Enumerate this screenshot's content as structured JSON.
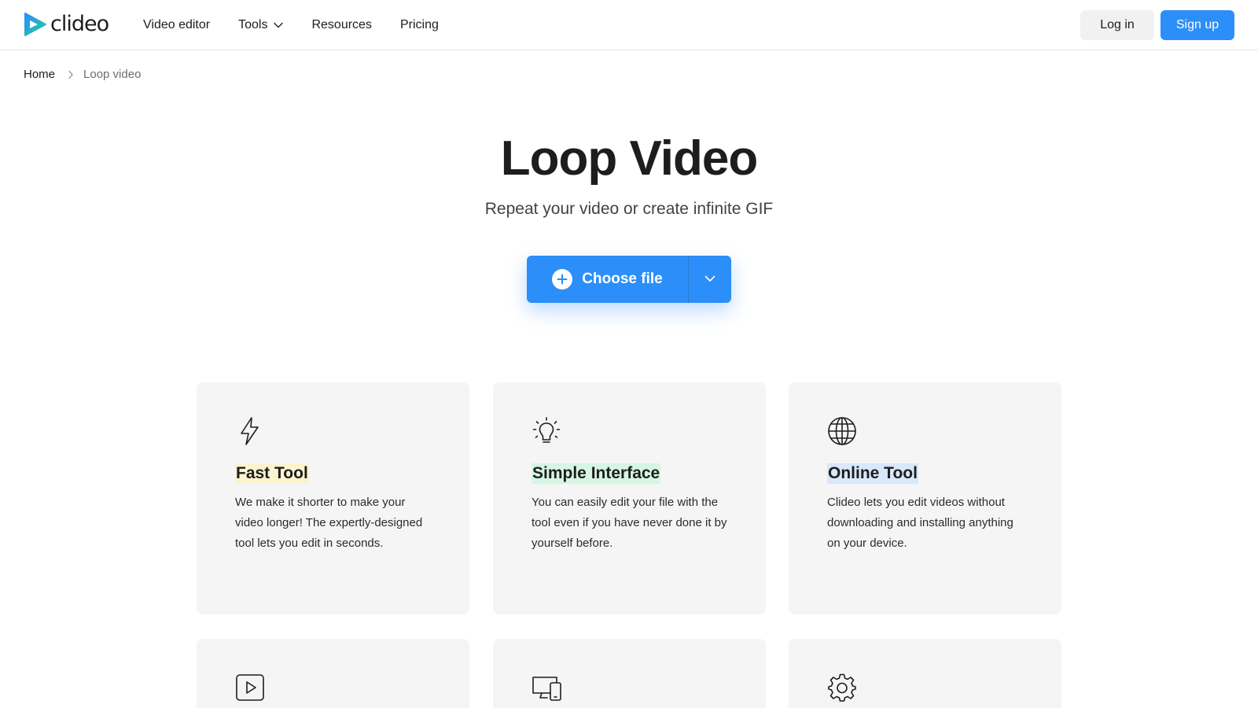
{
  "brand": {
    "name": "clideo",
    "primary": "#2c8ef8",
    "logo_gradient": [
      "#2c8ef8",
      "#1fcf9e"
    ]
  },
  "nav": {
    "items": [
      {
        "label": "Video editor",
        "has_dropdown": false
      },
      {
        "label": "Tools",
        "has_dropdown": true
      },
      {
        "label": "Resources",
        "has_dropdown": false
      },
      {
        "label": "Pricing",
        "has_dropdown": false
      }
    ],
    "login_label": "Log in",
    "signup_label": "Sign up"
  },
  "breadcrumb": {
    "home": "Home",
    "current": "Loop video"
  },
  "hero": {
    "title": "Loop Video",
    "subtitle": "Repeat your video or create infinite GIF",
    "upload_label": "Choose file"
  },
  "features": [
    {
      "title": "Fast Tool",
      "icon": "lightning-icon",
      "highlight": "#fcf3cf",
      "description": "We make it shorter to make your video longer! The expertly-designed tool lets you edit in seconds."
    },
    {
      "title": "Simple Interface",
      "icon": "lightbulb-icon",
      "highlight": "#d6f5e3",
      "description": "You can easily edit your file with the tool even if you have never done it by yourself before."
    },
    {
      "title": "Online Tool",
      "icon": "globe-icon",
      "highlight": "#d9e8fb",
      "description": "Clideo lets you edit videos without downloading and installing anything on your device."
    },
    {
      "title": "",
      "icon": "play-button-icon",
      "highlight": "",
      "description": ""
    },
    {
      "title": "",
      "icon": "devices-icon",
      "highlight": "",
      "description": ""
    },
    {
      "title": "",
      "icon": "gear-icon",
      "highlight": "",
      "description": ""
    }
  ]
}
